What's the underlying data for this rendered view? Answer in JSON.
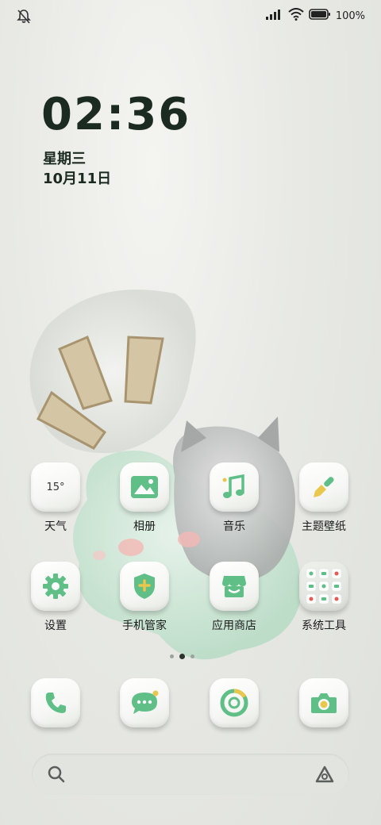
{
  "status": {
    "battery_text": "100%",
    "left_icon": "bell-off-icon",
    "right_icons": [
      "signal-icon",
      "wifi-icon",
      "battery-icon"
    ]
  },
  "lockclock": {
    "time": "02:36",
    "weekday": "星期三",
    "date": "10月11日"
  },
  "apps": [
    {
      "label": "天气",
      "icon": "weather-icon",
      "widget_text": "15°"
    },
    {
      "label": "相册",
      "icon": "gallery-icon"
    },
    {
      "label": "音乐",
      "icon": "music-icon"
    },
    {
      "label": "主题壁纸",
      "icon": "theme-brush-icon"
    },
    {
      "label": "设置",
      "icon": "settings-gear-icon"
    },
    {
      "label": "手机管家",
      "icon": "phone-manager-shield-icon"
    },
    {
      "label": "应用商店",
      "icon": "app-store-icon"
    },
    {
      "label": "系统工具",
      "icon": "system-tools-folder-icon"
    }
  ],
  "dock": [
    {
      "icon": "phone-icon"
    },
    {
      "icon": "messages-icon"
    },
    {
      "icon": "browser-icon"
    },
    {
      "icon": "camera-icon"
    }
  ],
  "pager": {
    "count": 3,
    "active": 1
  },
  "search": {
    "left_icon": "search-icon",
    "right_icon": "assistant-icon"
  },
  "colors": {
    "accent_green": "#5fbf86",
    "dark_text": "#1c2b22"
  }
}
